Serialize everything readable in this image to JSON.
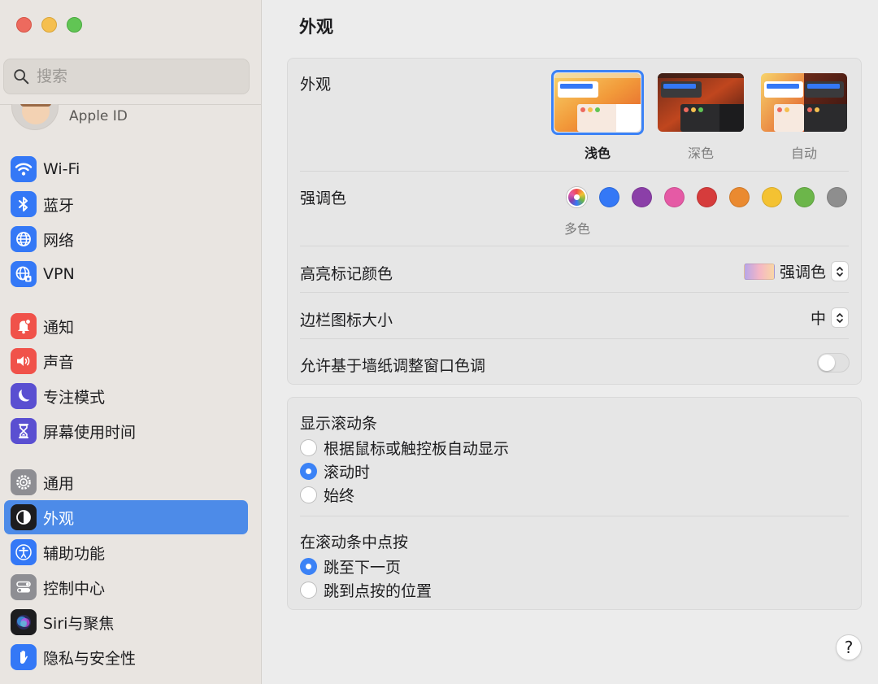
{
  "window": {
    "title": "外观"
  },
  "sidebar": {
    "search": {
      "placeholder": "搜索",
      "value": ""
    },
    "apple_id": {
      "label": "Apple ID"
    },
    "items": [
      {
        "id": "wifi",
        "label": "Wi-Fi",
        "icon": "wifi-icon",
        "color": "#3478f6"
      },
      {
        "id": "bluetooth",
        "label": "蓝牙",
        "icon": "bluetooth-icon",
        "color": "#3478f6"
      },
      {
        "id": "network",
        "label": "网络",
        "icon": "globe-icon",
        "color": "#3478f6"
      },
      {
        "id": "vpn",
        "label": "VPN",
        "icon": "vpn-globe-icon",
        "color": "#3478f6"
      },
      {
        "id": "notifications",
        "label": "通知",
        "icon": "bell-icon",
        "color": "#f0524a"
      },
      {
        "id": "sound",
        "label": "声音",
        "icon": "speaker-icon",
        "color": "#f0524a"
      },
      {
        "id": "focus",
        "label": "专注模式",
        "icon": "moon-icon",
        "color": "#5a4fd1"
      },
      {
        "id": "screentime",
        "label": "屏幕使用时间",
        "icon": "hourglass-icon",
        "color": "#5a4fd1"
      },
      {
        "id": "general",
        "label": "通用",
        "icon": "gear-icon",
        "color": "#8e8e93"
      },
      {
        "id": "appearance",
        "label": "外观",
        "icon": "appearance-icon",
        "color": "#1d1d1f",
        "active": true
      },
      {
        "id": "accessibility",
        "label": "辅助功能",
        "icon": "accessibility-icon",
        "color": "#3478f6"
      },
      {
        "id": "controlcenter",
        "label": "控制中心",
        "icon": "switches-icon",
        "color": "#8e8e93"
      },
      {
        "id": "siri",
        "label": "Siri与聚焦",
        "icon": "siri-icon",
        "color": "#1d1d1f"
      },
      {
        "id": "privacy",
        "label": "隐私与安全性",
        "icon": "hand-icon",
        "color": "#3478f6"
      }
    ]
  },
  "main": {
    "appearance": {
      "label": "外观",
      "options": [
        {
          "label": "浅色",
          "selected": true
        },
        {
          "label": "深色",
          "selected": false
        },
        {
          "label": "自动",
          "selected": false
        }
      ]
    },
    "accent": {
      "label": "强调色",
      "selected_caption": "多色",
      "colors": [
        "multicolor",
        "#3478f6",
        "#8b3fa8",
        "#e55aa5",
        "#d63c3c",
        "#ea8a30",
        "#f4c232",
        "#6cb64a",
        "#8e8e8e"
      ]
    },
    "highlight": {
      "label": "高亮标记颜色",
      "value": "强调色"
    },
    "sidebar_icon_size": {
      "label": "边栏图标大小",
      "value": "中"
    },
    "wallpaper_tinting": {
      "label": "允许基于墙纸调整窗口色调",
      "on": false
    },
    "scrollbars": {
      "title": "显示滚动条",
      "options": [
        {
          "label": "根据鼠标或触控板自动显示",
          "checked": false
        },
        {
          "label": "滚动时",
          "checked": true
        },
        {
          "label": "始终",
          "checked": false
        }
      ]
    },
    "click_in_scrollbar": {
      "title": "在滚动条中点按",
      "options": [
        {
          "label": "跳至下一页",
          "checked": true
        },
        {
          "label": "跳到点按的位置",
          "checked": false
        }
      ]
    },
    "help_label": "?"
  }
}
